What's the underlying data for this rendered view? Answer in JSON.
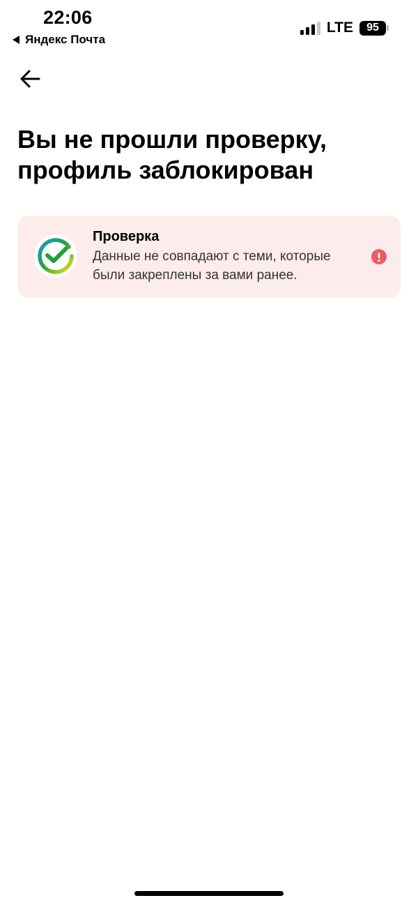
{
  "status_bar": {
    "time": "22:06",
    "back_app": "Яндекс Почта",
    "network": "LTE",
    "battery": "95"
  },
  "icons": {
    "back": "arrow-left-icon",
    "logo": "sber-check-logo-icon",
    "alert": "exclamation-circle-icon"
  },
  "page": {
    "title": "Вы не прошли проверку, профиль заблокирован"
  },
  "card": {
    "title": "Проверка",
    "text": "Данные не совпадают с теми, которые были закреплены за вами ранее."
  },
  "colors": {
    "card_background": "#fdecec",
    "alert": "#ef5b62",
    "logo_green": "#21a038",
    "logo_blue": "#1e9ce0",
    "logo_yellow": "#e8e31b"
  }
}
